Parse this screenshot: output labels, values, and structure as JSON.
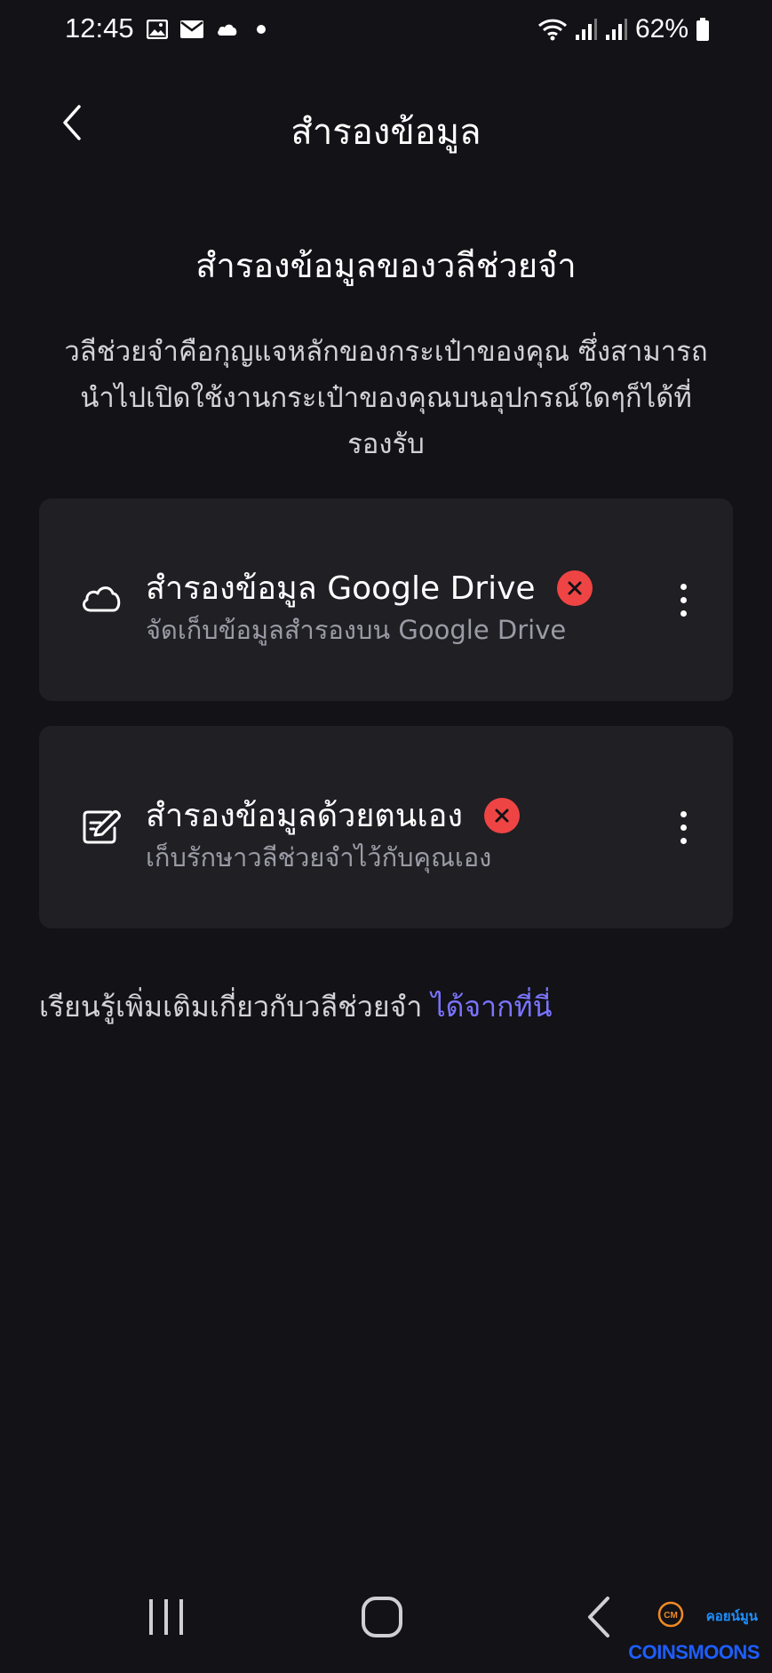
{
  "status_bar": {
    "time": "12:45",
    "battery": "62%"
  },
  "header": {
    "title": "สำรองข้อมูล"
  },
  "section": {
    "title": "สำรองข้อมูลของวลีช่วยจำ",
    "description": "วลีช่วยจำคือกุญแจหลักของกระเป๋าของคุณ ซึ่งสามารถนำไปเปิดใช้งานกระเป๋าของคุณบนอุปกรณ์ใดๆก็ได้ที่รองรับ"
  },
  "cards": [
    {
      "icon": "cloud-icon",
      "title": "สำรองข้อมูล Google Drive",
      "subtitle": "จัดเก็บข้อมูลสำรองบน Google Drive",
      "status": "not-backed-up"
    },
    {
      "icon": "manual-backup-icon",
      "title": "สำรองข้อมูลด้วยตนเอง",
      "subtitle": "เก็บรักษาวลีช่วยจำไว้กับคุณเอง",
      "status": "not-backed-up"
    }
  ],
  "learn_more": {
    "text": "เรียนรู้เพิ่มเติมเกี่ยวกับวลีช่วยจำ ",
    "link": "ได้จากที่นี่"
  },
  "watermark": {
    "coin_text": "CM",
    "brand_thai": "คอยน์มูน",
    "brand": "COINSMOONS"
  },
  "colors": {
    "background": "#121217",
    "card": "#1f1f24",
    "error": "#ef4444",
    "link": "#7b74ff"
  }
}
